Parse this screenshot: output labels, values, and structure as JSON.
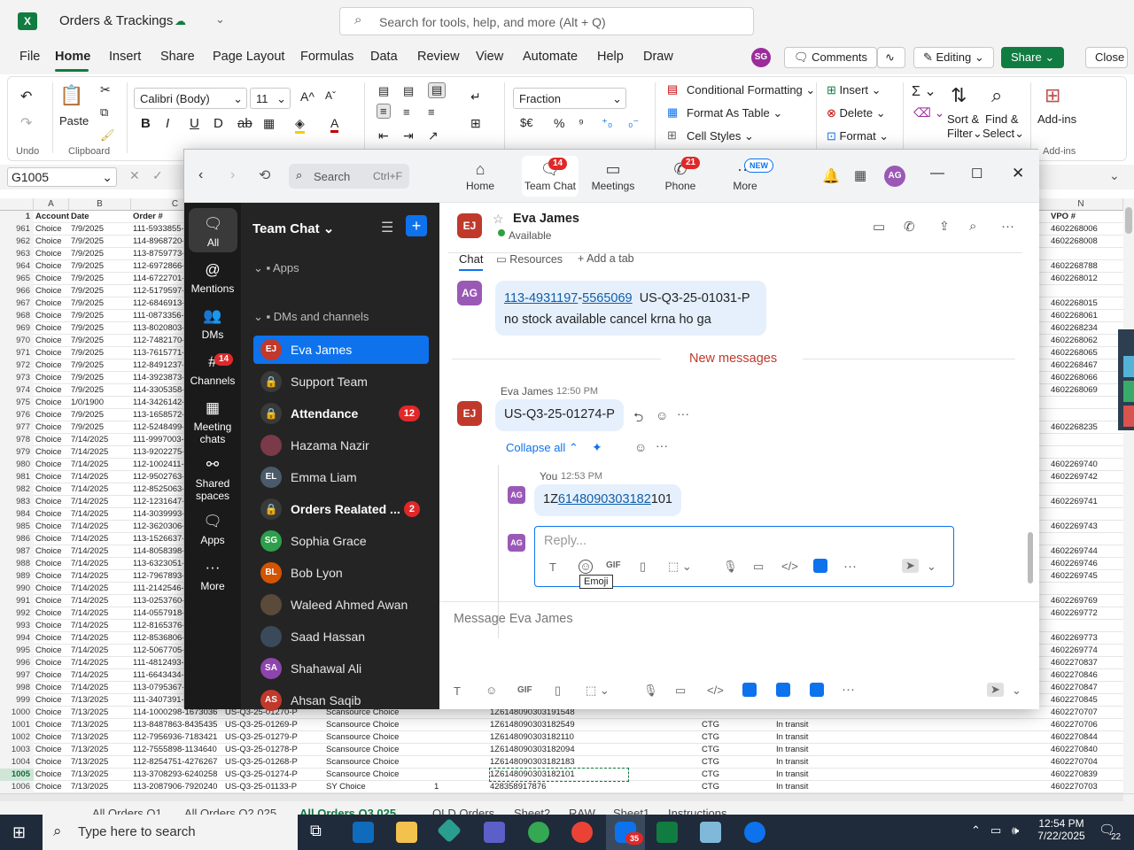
{
  "excel": {
    "doc_title": "Orders & Trackings",
    "search_placeholder": "Search for tools, help, and more (Alt + Q)",
    "menu": [
      "File",
      "Home",
      "Insert",
      "Share",
      "Page Layout",
      "Formulas",
      "Data",
      "Review",
      "View",
      "Automate",
      "Help",
      "Draw"
    ],
    "user_initials": "SG",
    "comments": "Comments",
    "editing": "Editing",
    "share": "Share",
    "close": "Close",
    "ribbon": {
      "undo": "Undo",
      "paste": "Paste",
      "clipboard": "Clipboard",
      "font": "Calibri (Body)",
      "size": "11",
      "number_format": "Fraction",
      "cond_format": "Conditional Formatting",
      "format_table": "Format As Table",
      "cell_styles": "Cell Styles",
      "insert": "Insert",
      "delete": "Delete",
      "format": "Format",
      "sort": "Sort &",
      "filter": "Filter",
      "find": "Find &",
      "select": "Select",
      "addins": "Add-ins",
      "addins_group": "Add-ins",
      "currency": "$€",
      "percent": "%"
    },
    "name_box": "G1005",
    "columns": [
      "A",
      "B",
      "C",
      "N"
    ],
    "header_row": {
      "num": "1",
      "account": "Account",
      "date": "Date",
      "order": "Order #",
      "vpo": "VPO #"
    },
    "rows": [
      {
        "n": "961",
        "a": "Choice",
        "d": "7/9/2025",
        "o": "111-5933855-",
        "v": "4602268006"
      },
      {
        "n": "962",
        "a": "Choice",
        "d": "7/9/2025",
        "o": "114-8968720-",
        "v": "4602268008"
      },
      {
        "n": "963",
        "a": "Choice",
        "d": "7/9/2025",
        "o": "113-8759773-",
        "v": ""
      },
      {
        "n": "964",
        "a": "Choice",
        "d": "7/9/2025",
        "o": "112-6972866-",
        "v": "4602268788"
      },
      {
        "n": "965",
        "a": "Choice",
        "d": "7/9/2025",
        "o": "114-6722701-",
        "v": "4602268012"
      },
      {
        "n": "966",
        "a": "Choice",
        "d": "7/9/2025",
        "o": "112-5179597-",
        "v": ""
      },
      {
        "n": "967",
        "a": "Choice",
        "d": "7/9/2025",
        "o": "112-6846913-",
        "v": "4602268015"
      },
      {
        "n": "968",
        "a": "Choice",
        "d": "7/9/2025",
        "o": "111-0873356-",
        "v": "4602268061"
      },
      {
        "n": "969",
        "a": "Choice",
        "d": "7/9/2025",
        "o": "113-8020803-",
        "v": "4602268234"
      },
      {
        "n": "970",
        "a": "Choice",
        "d": "7/9/2025",
        "o": "112-7482170-",
        "v": "4602268062"
      },
      {
        "n": "971",
        "a": "Choice",
        "d": "7/9/2025",
        "o": "113-7615771-",
        "v": "4602268065"
      },
      {
        "n": "972",
        "a": "Choice",
        "d": "7/9/2025",
        "o": "112-8491237-",
        "v": "4602268467"
      },
      {
        "n": "973",
        "a": "Choice",
        "d": "7/9/2025",
        "o": "114-3923873-",
        "v": "4602268066"
      },
      {
        "n": "974",
        "a": "Choice",
        "d": "7/9/2025",
        "o": "114-3305358-",
        "v": "4602268069"
      },
      {
        "n": "975",
        "a": "Choice",
        "d": "1/0/1900",
        "o": "114-3426142-",
        "v": ""
      },
      {
        "n": "976",
        "a": "Choice",
        "d": "7/9/2025",
        "o": "113-1658572-",
        "v": ""
      },
      {
        "n": "977",
        "a": "Choice",
        "d": "7/9/2025",
        "o": "112-5248499-",
        "v": "4602268235"
      },
      {
        "n": "978",
        "a": "Choice",
        "d": "7/14/2025",
        "o": "111-9997003-",
        "v": ""
      },
      {
        "n": "979",
        "a": "Choice",
        "d": "7/14/2025",
        "o": "113-9202275-",
        "v": ""
      },
      {
        "n": "980",
        "a": "Choice",
        "d": "7/14/2025",
        "o": "112-1002411-",
        "v": "4602269740"
      },
      {
        "n": "981",
        "a": "Choice",
        "d": "7/14/2025",
        "o": "112-9502763-",
        "v": "4602269742"
      },
      {
        "n": "982",
        "a": "Choice",
        "d": "7/14/2025",
        "o": "112-8525063-",
        "v": ""
      },
      {
        "n": "983",
        "a": "Choice",
        "d": "7/14/2025",
        "o": "112-1231647-",
        "v": "4602269741"
      },
      {
        "n": "984",
        "a": "Choice",
        "d": "7/14/2025",
        "o": "114-3039993-",
        "v": ""
      },
      {
        "n": "985",
        "a": "Choice",
        "d": "7/14/2025",
        "o": "112-3620306-",
        "v": "4602269743"
      },
      {
        "n": "986",
        "a": "Choice",
        "d": "7/14/2025",
        "o": "113-1526637-",
        "v": ""
      },
      {
        "n": "987",
        "a": "Choice",
        "d": "7/14/2025",
        "o": "114-8058398-",
        "v": "4602269744"
      },
      {
        "n": "988",
        "a": "Choice",
        "d": "7/14/2025",
        "o": "113-6323051-",
        "v": "4602269746"
      },
      {
        "n": "989",
        "a": "Choice",
        "d": "7/14/2025",
        "o": "112-7967893-",
        "v": "4602269745"
      },
      {
        "n": "990",
        "a": "Choice",
        "d": "7/14/2025",
        "o": "111-2142546-",
        "v": ""
      },
      {
        "n": "991",
        "a": "Choice",
        "d": "7/14/2025",
        "o": "113-0253760-",
        "v": "4602269769"
      },
      {
        "n": "992",
        "a": "Choice",
        "d": "7/14/2025",
        "o": "114-0557918-",
        "v": "4602269772"
      },
      {
        "n": "993",
        "a": "Choice",
        "d": "7/14/2025",
        "o": "112-8165376-",
        "v": ""
      },
      {
        "n": "994",
        "a": "Choice",
        "d": "7/14/2025",
        "o": "112-8536806-",
        "v": "4602269773"
      },
      {
        "n": "995",
        "a": "Choice",
        "d": "7/14/2025",
        "o": "112-5067705-",
        "v": "4602269774"
      },
      {
        "n": "996",
        "a": "Choice",
        "d": "7/14/2025",
        "o": "111-4812493-",
        "v": "4602270837"
      },
      {
        "n": "997",
        "a": "Choice",
        "d": "7/14/2025",
        "o": "111-6643434-",
        "v": "4602270846"
      },
      {
        "n": "998",
        "a": "Choice",
        "d": "7/14/2025",
        "o": "113-0795367-",
        "v": "4602270847"
      },
      {
        "n": "999",
        "a": "Choice",
        "d": "7/13/2025",
        "o": "111-3407391-",
        "v": "4602270845"
      }
    ],
    "bottom_rows": [
      {
        "n": "1000",
        "a": "Choice",
        "d": "7/13/2025",
        "o": "114-1000298-1673036",
        "p": "US-Q3-25-01270-P",
        "s": "Scansource Choice",
        "q": "",
        "t": "1Z6148090303191548",
        "c": "",
        "st": "",
        "v": "4602270707"
      },
      {
        "n": "1001",
        "a": "Choice",
        "d": "7/13/2025",
        "o": "113-8487863-8435435",
        "p": "US-Q3-25-01269-P",
        "s": "Scansource Choice",
        "q": "",
        "t": "1Z6148090303182549",
        "c": "CTG",
        "st": "In transit",
        "v": "4602270706"
      },
      {
        "n": "1002",
        "a": "Choice",
        "d": "7/13/2025",
        "o": "112-7956936-7183421",
        "p": "US-Q3-25-01279-P",
        "s": "Scansource Choice",
        "q": "",
        "t": "1Z6148090303182110",
        "c": "CTG",
        "st": "In transit",
        "v": "4602270844"
      },
      {
        "n": "1003",
        "a": "Choice",
        "d": "7/13/2025",
        "o": "112-7555898-1134640",
        "p": "US-Q3-25-01278-P",
        "s": "Scansource Choice",
        "q": "",
        "t": "1Z6148090303182094",
        "c": "CTG",
        "st": "In transit",
        "v": "4602270840"
      },
      {
        "n": "1004",
        "a": "Choice",
        "d": "7/13/2025",
        "o": "112-8254751-4276267",
        "p": "US-Q3-25-01268-P",
        "s": "Scansource Choice",
        "q": "",
        "t": "1Z6148090303182183",
        "c": "CTG",
        "st": "In transit",
        "v": "4602270704"
      },
      {
        "n": "1005",
        "a": "Choice",
        "d": "7/13/2025",
        "o": "113-3708293-6240258",
        "p": "US-Q3-25-01274-P",
        "s": "Scansource Choice",
        "q": "",
        "t": "1Z6148090303182101",
        "c": "CTG",
        "st": "In transit",
        "v": "4602270839"
      },
      {
        "n": "1006",
        "a": "Choice",
        "d": "7/13/2025",
        "o": "113-2087906-7920240",
        "p": "US-Q3-25-01133-P",
        "s": "SY Choice",
        "q": "1",
        "t": "428358917876",
        "c": "CTG",
        "st": "In transit",
        "v": "4602270703"
      }
    ],
    "sheet_tabs": [
      "All Orders Q1",
      "All Orders Q2 025",
      "All Orders Q3 025",
      "OLD Orders",
      "Sheet2",
      "RAW",
      "Sheet1",
      "Instructions"
    ]
  },
  "zoom": {
    "search": "Search",
    "search_shortcut": "Ctrl+F",
    "nav": [
      {
        "label": "Home"
      },
      {
        "label": "Team Chat",
        "badge": "14"
      },
      {
        "label": "Meetings"
      },
      {
        "label": "Phone",
        "badge": "21"
      },
      {
        "label": "More",
        "badge": "NEW"
      }
    ],
    "user_initials": "AG",
    "rail": [
      {
        "label": "All"
      },
      {
        "label": "Mentions"
      },
      {
        "label": "DMs"
      },
      {
        "label": "Channels",
        "badge": "14"
      },
      {
        "label": "Meeting chats"
      },
      {
        "label": "Shared spaces"
      },
      {
        "label": "Apps"
      },
      {
        "label": "More"
      }
    ],
    "list_title": "Team Chat",
    "sections": {
      "apps": "Apps",
      "dms": "DMs and channels"
    },
    "channels": [
      {
        "name": "Eva James",
        "initials": "EJ",
        "color": "#c0392b",
        "active": true
      },
      {
        "name": "Support Team",
        "initials": "",
        "color": "#555",
        "lock": true
      },
      {
        "name": "Attendance",
        "initials": "",
        "color": "#555",
        "lock": true,
        "bold": true,
        "count": "12"
      },
      {
        "name": "Hazama Nazir",
        "initials": "",
        "color": "#7a3a4a"
      },
      {
        "name": "Emma Liam",
        "initials": "EL",
        "color": "#4a5a6a"
      },
      {
        "name": "Orders Realated ...",
        "initials": "",
        "color": "#555",
        "lock": true,
        "bold": true,
        "count": "2"
      },
      {
        "name": "Sophia Grace",
        "initials": "SG",
        "color": "#2e9e4b"
      },
      {
        "name": "Bob Lyon",
        "initials": "BL",
        "color": "#d35400"
      },
      {
        "name": "Waleed Ahmed Awan",
        "initials": "",
        "color": "#5a4a3a"
      },
      {
        "name": "Saad Hassan",
        "initials": "",
        "color": "#3a4a5a"
      },
      {
        "name": "Shahawal Ali",
        "initials": "SA",
        "color": "#8e44ad"
      },
      {
        "name": "Ahsan Saqib",
        "initials": "AS",
        "color": "#c0392b"
      }
    ],
    "chat": {
      "contact": "Eva James",
      "contact_initials": "EJ",
      "status": "Available",
      "tabs": [
        "Chat",
        "Resources",
        "Add a tab"
      ],
      "msg1_a": "113-4931197",
      "msg1_b": "5565069",
      "msg1_c": "US-Q3-25-01031-P",
      "msg1_d": "no stock available cancel krna ho ga",
      "new_messages": "New messages",
      "msg2_sender": "Eva James",
      "msg2_time": "12:50 PM",
      "msg2_text": "US-Q3-25-01274-P",
      "collapse": "Collapse all",
      "reply_sender": "You",
      "reply_time": "12:53 PM",
      "reply_pre": "1Z",
      "reply_link": "6148090303182",
      "reply_post": "101",
      "reply_placeholder": "Reply...",
      "tooltip": "Emoji",
      "composer_placeholder": "Message Eva James"
    }
  },
  "taskbar": {
    "search": "Type here to search",
    "time": "12:54 PM",
    "date": "7/22/2025",
    "notif": "22",
    "zoom_badge": "35"
  }
}
